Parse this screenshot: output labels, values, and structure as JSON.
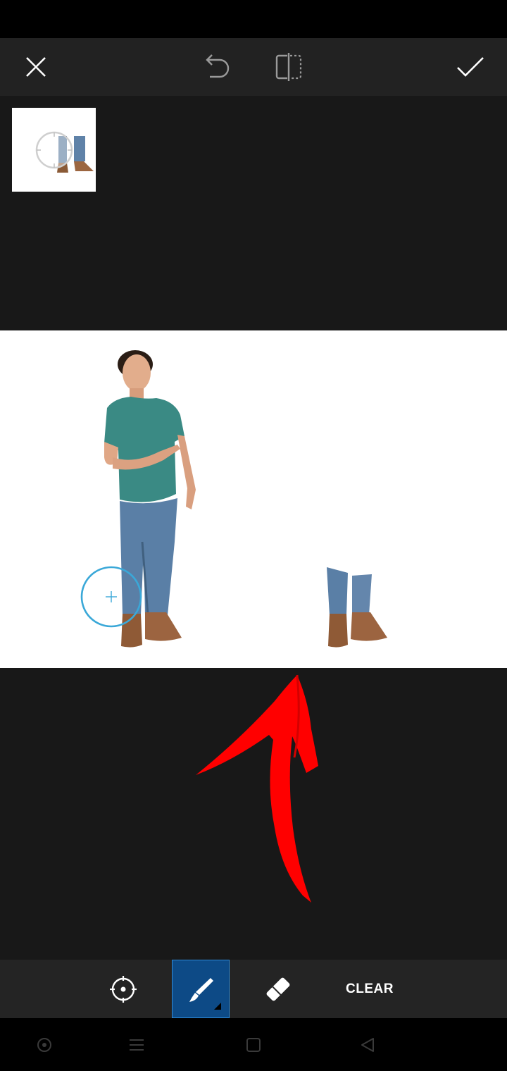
{
  "toolbar": {
    "close_icon": "close-icon",
    "undo_icon": "undo-icon",
    "compare_icon": "compare-icon",
    "apply_icon": "check-icon"
  },
  "tools": {
    "items": [
      {
        "icon": "target-icon",
        "name": "select-object-tool",
        "active": false
      },
      {
        "icon": "brush-icon",
        "name": "brush-tool",
        "active": true
      },
      {
        "icon": "eraser-icon",
        "name": "eraser-tool",
        "active": false
      }
    ],
    "clear_label": "CLEAR"
  },
  "colors": {
    "background": "#181818",
    "toolbar": "#222222",
    "active_tool": "#0d4a86",
    "brush_cursor": "#3aa8d8",
    "annotation_arrow": "#ff0000"
  },
  "nav": {
    "items": [
      "home-circle-icon",
      "menu-icon",
      "recents-square-icon",
      "back-triangle-icon"
    ]
  }
}
